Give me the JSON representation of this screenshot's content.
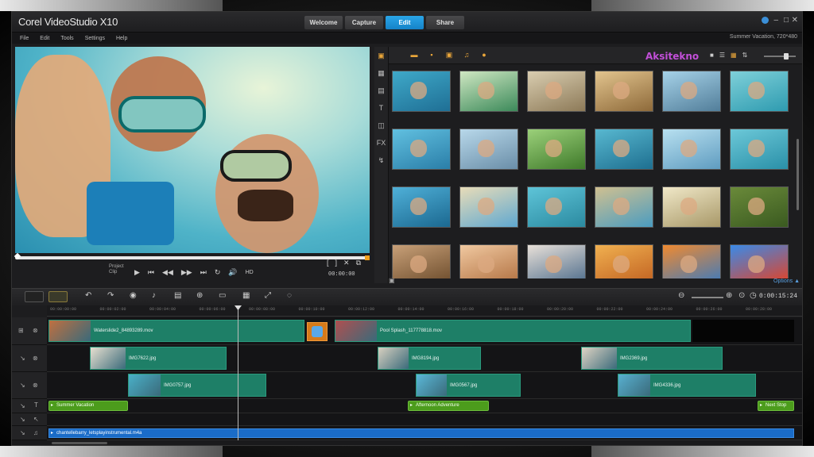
{
  "app": {
    "title": "Corel VideoStudio X10",
    "project_name": "Summer Vacation, 720*480"
  },
  "workspace_tabs": [
    {
      "label": "Welcome",
      "active": false
    },
    {
      "label": "Capture",
      "active": false
    },
    {
      "label": "Edit",
      "active": true
    },
    {
      "label": "Share",
      "active": false
    }
  ],
  "window_controls": {
    "minimize": "–",
    "maximize": "□",
    "close": "✕",
    "help": "?"
  },
  "menu": [
    "File",
    "Edit",
    "Tools",
    "Settings",
    "Help"
  ],
  "preview": {
    "mode_project": "Project",
    "mode_clip": "Clip",
    "timecode": "00:00:00",
    "controls": {
      "play": "▶",
      "home": "⏮",
      "prev": "◀◀",
      "next": "▶▶",
      "end": "⏭",
      "repeat": "↻",
      "volume": "🔊",
      "hd": "HD"
    },
    "trim": {
      "mark_in": "[",
      "mark_out": "]",
      "split": "✕",
      "copy": "⧉"
    }
  },
  "library": {
    "brand": "Aksitekno",
    "options_label": "Options ▲",
    "thumbnails": [
      {
        "c1": "#3fa9c9",
        "c2": "#1f6f95"
      },
      {
        "c1": "#cfe7c2",
        "c2": "#3c8a5a"
      },
      {
        "c1": "#d9cdb0",
        "c2": "#8d7a58"
      },
      {
        "c1": "#e2c48e",
        "c2": "#8e6a3a"
      },
      {
        "c1": "#a6d2e8",
        "c2": "#527e9a"
      },
      {
        "c1": "#7fd0d9",
        "c2": "#2e9bb0"
      },
      {
        "c1": "#61c0e0",
        "c2": "#2a7ea8"
      },
      {
        "c1": "#b8d8ea",
        "c2": "#6a8ea8"
      },
      {
        "c1": "#9bd07a",
        "c2": "#3f7a2a"
      },
      {
        "c1": "#58b8d0",
        "c2": "#1e6f90"
      },
      {
        "c1": "#b8e0f0",
        "c2": "#5f9cc0"
      },
      {
        "c1": "#6cc8d8",
        "c2": "#2a90a8"
      },
      {
        "c1": "#4fb0d8",
        "c2": "#1b6890"
      },
      {
        "c1": "#e8dcb8",
        "c2": "#5fa8d0"
      },
      {
        "c1": "#5ec4d8",
        "c2": "#2b8aa0"
      },
      {
        "c1": "#d0c090",
        "c2": "#4a9cc0"
      },
      {
        "c1": "#f0e8c8",
        "c2": "#a89868"
      },
      {
        "c1": "#6a8a3a",
        "c2": "#3a5a20"
      },
      {
        "c1": "#c8a078",
        "c2": "#6a4a2a"
      },
      {
        "c1": "#f0c8a0",
        "c2": "#b07040"
      },
      {
        "c1": "#e8e0d8",
        "c2": "#4a6a8a"
      },
      {
        "c1": "#f0b050",
        "c2": "#c06020"
      },
      {
        "c1": "#f08a30",
        "c2": "#3a7ac0"
      },
      {
        "c1": "#3a8ae8",
        "c2": "#e84020"
      }
    ]
  },
  "timeline": {
    "timecode": "0:00:15:24",
    "ruler": [
      "00:00:00:00",
      "00:00:02:00",
      "00:00:04:00",
      "00:00:06:00",
      "00:00:08:00",
      "00:00:10:00",
      "00:00:12:00",
      "00:00:14:00",
      "00:00:16:00",
      "00:00:18:00",
      "00:00:20:00",
      "00:00:22:00",
      "00:00:24:00",
      "00:00:26:00",
      "00:00:28:00"
    ],
    "video_track": [
      {
        "label": "Waterslide2_84893289.mov",
        "thumb": "#c07040"
      },
      {
        "label": "Pool Splash_117778818.mov",
        "thumb": "#b05050"
      }
    ],
    "overlay1": [
      {
        "label": "IMG7622.jpg",
        "thumb": "#e8e0d0"
      },
      {
        "label": "IMG8194.jpg",
        "thumb": "#d8d0c0"
      },
      {
        "label": "IMG2369.jpg",
        "thumb": "#e0d4c4"
      }
    ],
    "overlay2": [
      {
        "label": "IMG0757.jpg",
        "thumb": "#4ab0c8"
      },
      {
        "label": "IMG0567.jpg",
        "thumb": "#5ab8d8"
      },
      {
        "label": "IMG4336.jpg",
        "thumb": "#58b0d0"
      }
    ],
    "titles": [
      "Summer Vacation",
      "Afternoon Adventure",
      "Next Stop"
    ],
    "music": "chantellebarry_letsplayinstrumental.m4a"
  }
}
